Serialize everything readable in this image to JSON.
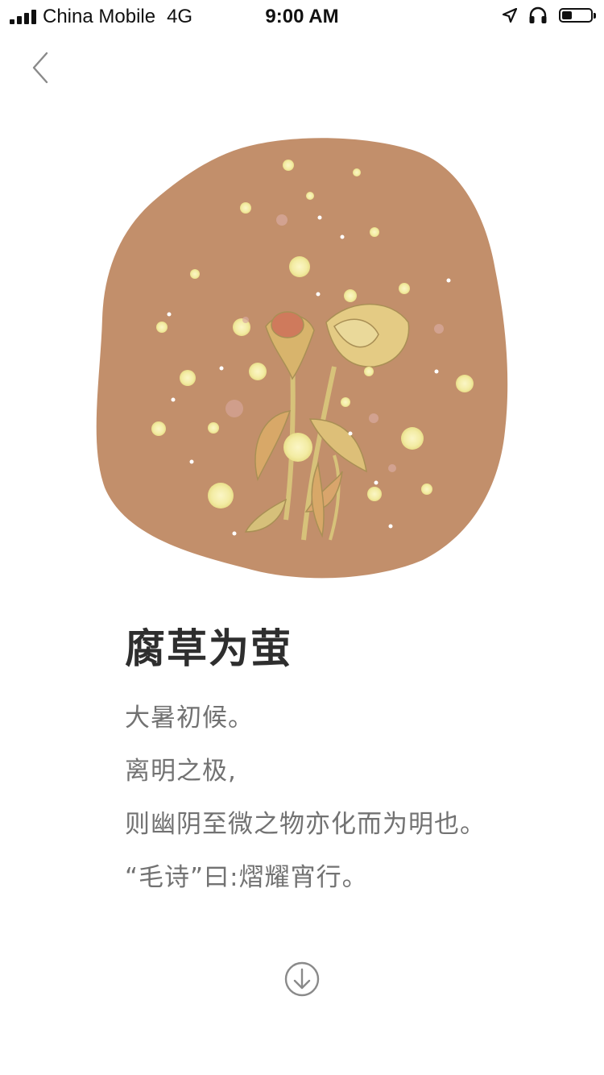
{
  "status_bar": {
    "carrier": "China Mobile",
    "network": "4G",
    "time": "9:00 AM",
    "battery_level": 0.35
  },
  "nav": {
    "back_icon": "chevron-left-icon"
  },
  "illustration": {
    "subject": "wilted-flowers-with-fireflies",
    "blob_color": "#c28f6b",
    "glow_color": "#f6f0b0"
  },
  "article": {
    "title": "腐草为萤",
    "lines": [
      "大暑初候。",
      "离明之极,",
      "则幽阴至微之物亦化而为明也。",
      "“毛诗”曰:熠耀宵行。"
    ]
  },
  "footer": {
    "download_icon": "arrow-down-circle-icon"
  }
}
